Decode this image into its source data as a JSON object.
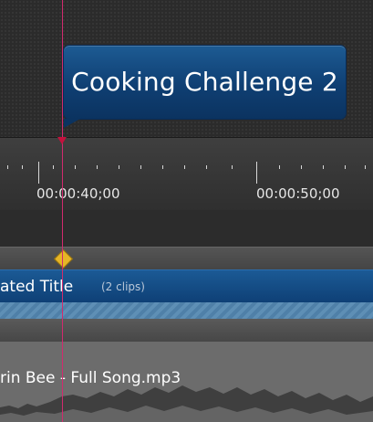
{
  "preview": {
    "title_overlay": "Cooking Challenge 2"
  },
  "timeline": {
    "ruler": {
      "labels": [
        "00:00:40;00",
        "00:00:50;00"
      ]
    },
    "title_track": {
      "clip_title": "ated Title",
      "clip_count": "(2 clips)"
    },
    "audio_track": {
      "clip_title": "rin Bee - Full Song.mp3"
    }
  },
  "colors": {
    "playhead": "#d12a6e",
    "title_clip": "#0e3f75",
    "marker": "#e6b527"
  }
}
